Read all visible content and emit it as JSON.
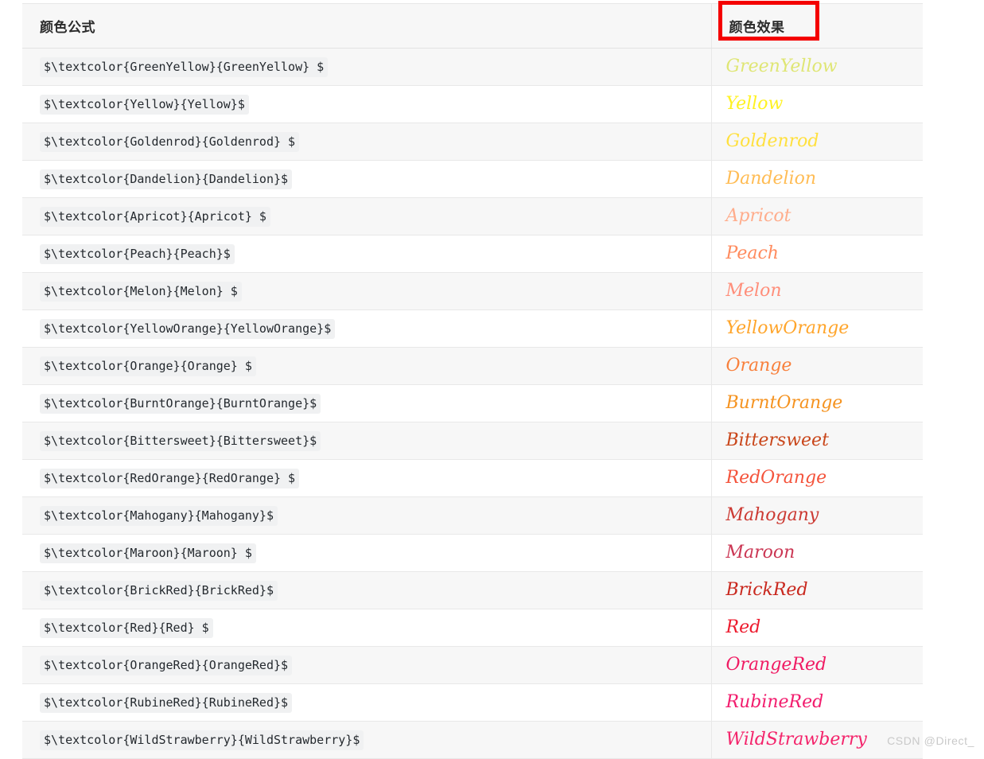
{
  "table": {
    "headers": {
      "formula": "颜色公式",
      "effect": "颜色效果"
    },
    "rows": [
      {
        "formula": "$\\textcolor{GreenYellow}{GreenYellow} $",
        "sample": "GreenYellow",
        "color": "#DFE674"
      },
      {
        "formula": "$\\textcolor{Yellow}{Yellow}$",
        "sample": "Yellow",
        "color": "#FFF222"
      },
      {
        "formula": "$\\textcolor{Goldenrod}{Goldenrod} $",
        "sample": "Goldenrod",
        "color": "#FFE03E"
      },
      {
        "formula": "$\\textcolor{Dandelion}{Dandelion}$",
        "sample": "Dandelion",
        "color": "#FFBC54"
      },
      {
        "formula": "$\\textcolor{Apricot}{Apricot} $",
        "sample": "Apricot",
        "color": "#FFAD8C"
      },
      {
        "formula": "$\\textcolor{Peach}{Peach}$",
        "sample": "Peach",
        "color": "#FF8B5E"
      },
      {
        "formula": "$\\textcolor{Melon}{Melon} $",
        "sample": "Melon",
        "color": "#FF8E7A"
      },
      {
        "formula": "$\\textcolor{YellowOrange}{YellowOrange}$",
        "sample": "YellowOrange",
        "color": "#FFA52B"
      },
      {
        "formula": "$\\textcolor{Orange}{Orange} $",
        "sample": "Orange",
        "color": "#F8803C"
      },
      {
        "formula": "$\\textcolor{BurntOrange}{BurntOrange}$",
        "sample": "BurntOrange",
        "color": "#F59320"
      },
      {
        "formula": "$\\textcolor{Bittersweet}{Bittersweet}$",
        "sample": "Bittersweet",
        "color": "#C9461A"
      },
      {
        "formula": "$\\textcolor{RedOrange}{RedOrange} $",
        "sample": "RedOrange",
        "color": "#F4543C"
      },
      {
        "formula": "$\\textcolor{Mahogany}{Mahogany}$",
        "sample": "Mahogany",
        "color": "#CC3A33"
      },
      {
        "formula": "$\\textcolor{Maroon}{Maroon} $",
        "sample": "Maroon",
        "color": "#CB3754"
      },
      {
        "formula": "$\\textcolor{BrickRed}{BrickRed}$",
        "sample": "BrickRed",
        "color": "#C9281E"
      },
      {
        "formula": "$\\textcolor{Red}{Red} $",
        "sample": "Red",
        "color": "#ED1B2E"
      },
      {
        "formula": "$\\textcolor{OrangeRed}{OrangeRed}$",
        "sample": "OrangeRed",
        "color": "#F01B63"
      },
      {
        "formula": "$\\textcolor{RubineRed}{RubineRed}$",
        "sample": "RubineRed",
        "color": "#F21D6E"
      },
      {
        "formula": "$\\textcolor{WildStrawberry}{WildStrawberry}$",
        "sample": "WildStrawberry",
        "color": "#F4246B"
      }
    ]
  },
  "annotation": {
    "target": "颜色效果",
    "color": "#f40000"
  },
  "watermark": {
    "text": "CSDN @Direct_"
  }
}
